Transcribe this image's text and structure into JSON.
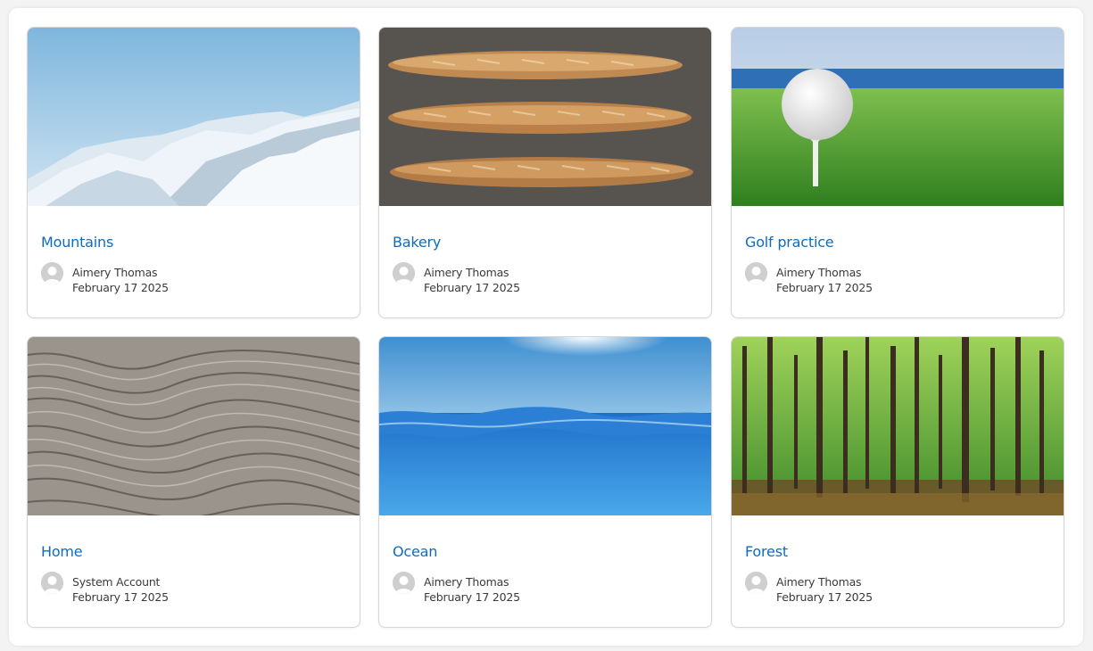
{
  "cards": [
    {
      "title": "Mountains",
      "author": "Aimery Thomas",
      "date": "February 17 2025",
      "image": "snowy-mountains"
    },
    {
      "title": "Bakery",
      "author": "Aimery Thomas",
      "date": "February 17 2025",
      "image": "baguettes"
    },
    {
      "title": "Golf practice",
      "author": "Aimery Thomas",
      "date": "February 17 2025",
      "image": "golf-ball-on-tee"
    },
    {
      "title": "Home",
      "author": "System Account",
      "date": "February 17 2025",
      "image": "wood-grain"
    },
    {
      "title": "Ocean",
      "author": "Aimery Thomas",
      "date": "February 17 2025",
      "image": "ocean-surface"
    },
    {
      "title": "Forest",
      "author": "Aimery Thomas",
      "date": "February 17 2025",
      "image": "forest-trees"
    }
  ],
  "colors": {
    "title_link": "#0f6cbd",
    "meta_text": "#3a3a3a",
    "card_border": "#d6d6d6"
  }
}
